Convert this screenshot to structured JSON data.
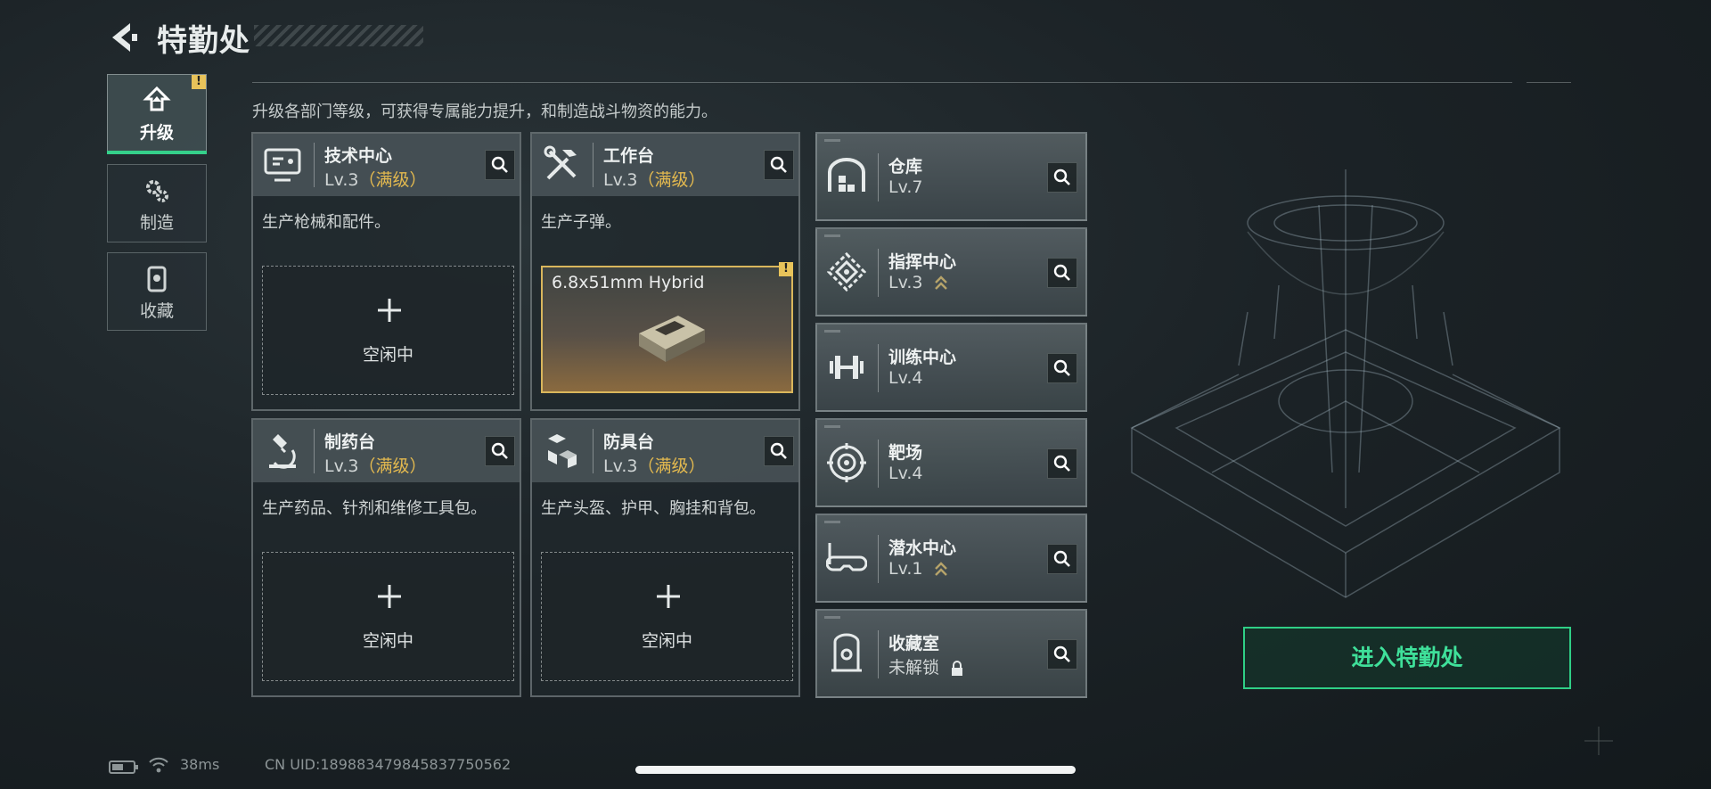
{
  "header": {
    "title": "特勤处"
  },
  "tabs": [
    {
      "label": "升级",
      "icon": "upgrade-icon",
      "active": true,
      "alert": "!"
    },
    {
      "label": "制造",
      "icon": "gear-icon",
      "active": false
    },
    {
      "label": "收藏",
      "icon": "collection-icon",
      "active": false
    }
  ],
  "subtitle": "升级各部门等级，可获得专属能力提升，和制造战斗物资的能力。",
  "workshops": [
    {
      "name": "技术中心",
      "level": "Lv.3",
      "max_label": "（满级）",
      "desc": "生产枪械和配件。",
      "slot_status": "空闲中",
      "icon": "monitor-icon"
    },
    {
      "name": "工作台",
      "level": "Lv.3",
      "max_label": "（满级）",
      "desc": "生产子弹。",
      "crafting_item": "6.8x51mm Hybrid",
      "alert": "!",
      "icon": "tools-icon"
    },
    {
      "name": "制药台",
      "level": "Lv.3",
      "max_label": "（满级）",
      "desc": "生产药品、针剂和维修工具包。",
      "slot_status": "空闲中",
      "icon": "microscope-icon"
    },
    {
      "name": "防具台",
      "level": "Lv.3",
      "max_label": "（满级）",
      "desc": "生产头盔、护甲、胸挂和背包。",
      "slot_status": "空闲中",
      "icon": "armor-blocks-icon"
    }
  ],
  "buildings": [
    {
      "name": "仓库",
      "level": "Lv.7",
      "icon": "warehouse-icon",
      "upgradable": false
    },
    {
      "name": "指挥中心",
      "level": "Lv.3",
      "icon": "command-icon",
      "upgradable": true
    },
    {
      "name": "训练中心",
      "level": "Lv.4",
      "icon": "dumbbell-icon",
      "upgradable": false
    },
    {
      "name": "靶场",
      "level": "Lv.4",
      "icon": "target-icon",
      "upgradable": false
    },
    {
      "name": "潜水中心",
      "level": "Lv.1",
      "icon": "diving-mask-icon",
      "upgradable": true
    },
    {
      "name": "收藏室",
      "level": "未解锁",
      "icon": "collection-room-icon",
      "locked": true
    }
  ],
  "enter_button": "进入特勤处",
  "status": {
    "ping": "38ms",
    "uid": "CN UID:18988347984583775056​2"
  },
  "colors": {
    "accent": "#35d08a",
    "max_level": "#e3b94f",
    "alert": "#e8c35a"
  }
}
